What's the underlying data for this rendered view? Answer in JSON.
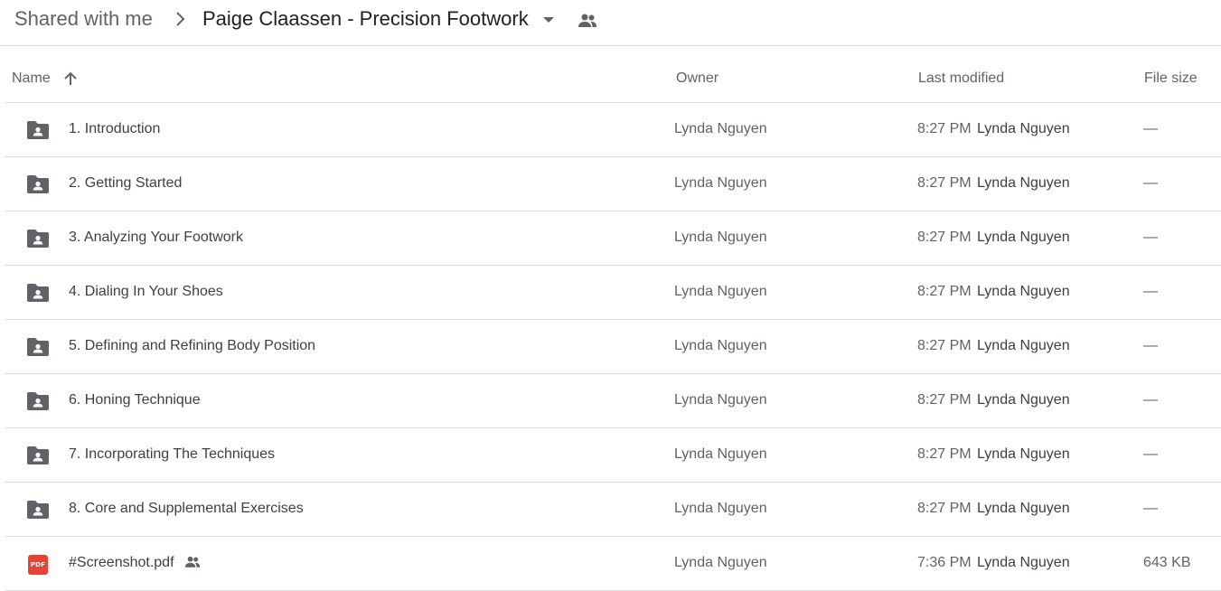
{
  "breadcrumb": {
    "root": "Shared with me",
    "current": "Paige Claassen - Precision Footwork"
  },
  "columns": {
    "name": "Name",
    "owner": "Owner",
    "last_modified": "Last modified",
    "file_size": "File size"
  },
  "files": [
    {
      "name": "1. Introduction",
      "type": "shared-folder",
      "owner": "Lynda Nguyen",
      "modified_time": "8:27 PM",
      "modified_by": "Lynda Nguyen",
      "size": "—"
    },
    {
      "name": "2. Getting Started",
      "type": "shared-folder",
      "owner": "Lynda Nguyen",
      "modified_time": "8:27 PM",
      "modified_by": "Lynda Nguyen",
      "size": "—"
    },
    {
      "name": "3. Analyzing Your Footwork",
      "type": "shared-folder",
      "owner": "Lynda Nguyen",
      "modified_time": "8:27 PM",
      "modified_by": "Lynda Nguyen",
      "size": "—"
    },
    {
      "name": "4. Dialing In Your Shoes",
      "type": "shared-folder",
      "owner": "Lynda Nguyen",
      "modified_time": "8:27 PM",
      "modified_by": "Lynda Nguyen",
      "size": "—"
    },
    {
      "name": "5. Defining and Refining Body Position",
      "type": "shared-folder",
      "owner": "Lynda Nguyen",
      "modified_time": "8:27 PM",
      "modified_by": "Lynda Nguyen",
      "size": "—"
    },
    {
      "name": "6. Honing Technique",
      "type": "shared-folder",
      "owner": "Lynda Nguyen",
      "modified_time": "8:27 PM",
      "modified_by": "Lynda Nguyen",
      "size": "—"
    },
    {
      "name": "7. Incorporating The Techniques",
      "type": "shared-folder",
      "owner": "Lynda Nguyen",
      "modified_time": "8:27 PM",
      "modified_by": "Lynda Nguyen",
      "size": "—"
    },
    {
      "name": "8. Core and Supplemental Exercises",
      "type": "shared-folder",
      "owner": "Lynda Nguyen",
      "modified_time": "8:27 PM",
      "modified_by": "Lynda Nguyen",
      "size": "—"
    },
    {
      "name": "#Screenshot.pdf",
      "type": "pdf",
      "pdf_badge": "PDF",
      "shared": true,
      "owner": "Lynda Nguyen",
      "modified_time": "7:36 PM",
      "modified_by": "Lynda Nguyen",
      "size": "643 KB"
    }
  ],
  "colors": {
    "icon": "#5f6368",
    "pdf": "#ea4335",
    "divider": "#dadce0"
  }
}
